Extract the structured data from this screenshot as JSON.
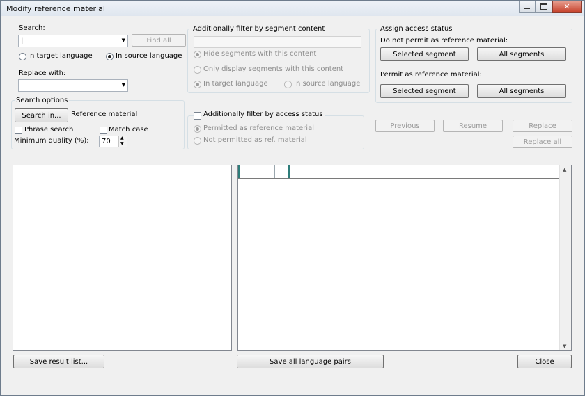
{
  "window": {
    "title": "Modify reference material"
  },
  "search": {
    "label": "Search:",
    "value": "|",
    "find_all": "Find all",
    "radio_target": "In target language",
    "radio_source": "In source language",
    "selected_radio": "source"
  },
  "replace": {
    "label": "Replace with:",
    "value": ""
  },
  "search_options": {
    "legend": "Search options",
    "search_in_button": "Search in...",
    "search_in_value": "Reference material",
    "phrase_search": "Phrase search",
    "match_case": "Match case",
    "min_quality_label": "Minimum quality (%):",
    "min_quality_value": "70"
  },
  "segment_filter": {
    "legend": "Additionally filter by segment content",
    "input_value": "",
    "hide_segments": "Hide segments with this content",
    "only_display": "Only display segments with this content",
    "in_target": "In target language",
    "in_source": "In source language"
  },
  "access_filter": {
    "legend": "Additionally filter by access status",
    "permitted": "Permitted as reference material",
    "not_permitted": "Not permitted as ref. material"
  },
  "assign": {
    "legend": "Assign access status",
    "do_not_permit_label": "Do not permit as reference material:",
    "permit_label": "Permit as reference material:",
    "selected_segment": "Selected segment",
    "all_segments": "All segments"
  },
  "actions": {
    "previous": "Previous",
    "resume": "Resume",
    "replace": "Replace",
    "replace_all": "Replace all"
  },
  "bottom": {
    "save_result_list": "Save result list...",
    "save_all_language_pairs": "Save all language pairs",
    "close": "Close"
  },
  "colors": {
    "accent": "#2e7d7a",
    "title_bar": "#dfe6ef"
  }
}
